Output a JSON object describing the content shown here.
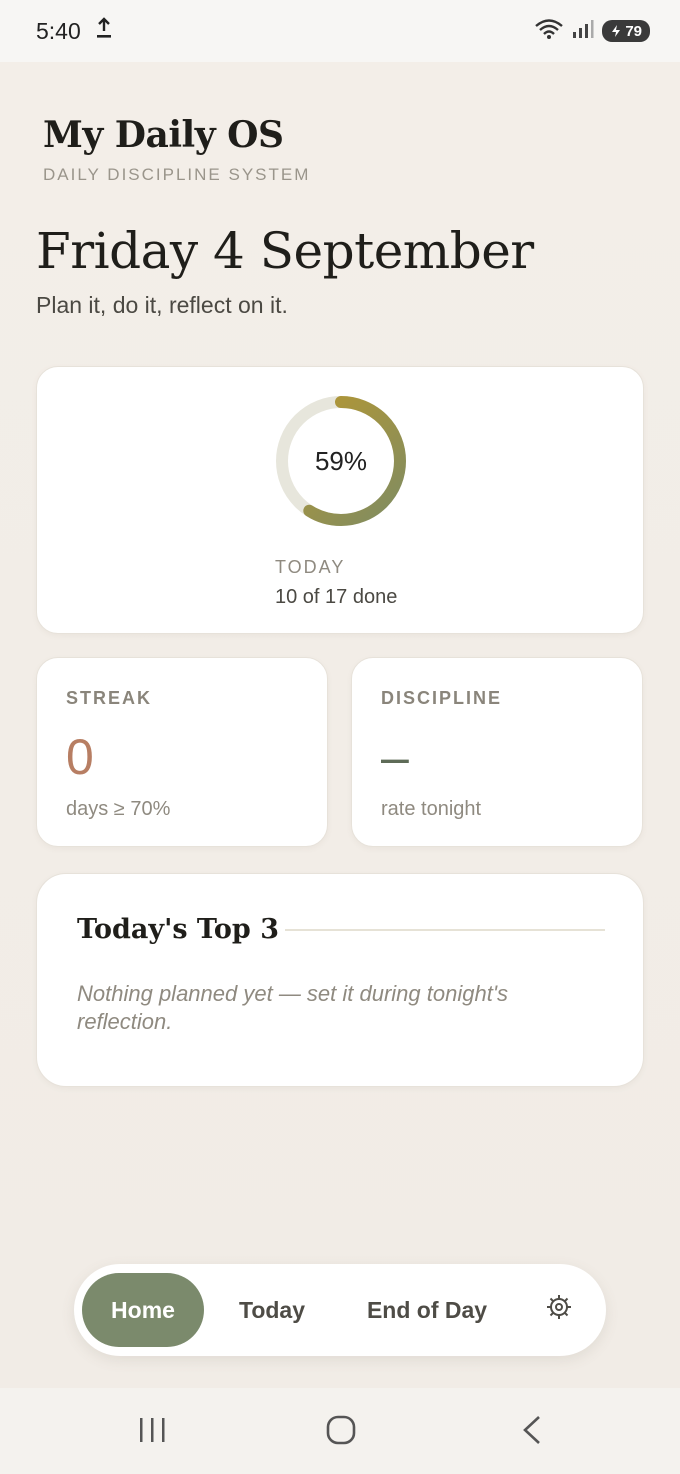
{
  "status_bar": {
    "time": "5:40",
    "battery": "79",
    "icons": [
      "upload-icon",
      "wifi-icon",
      "signal-icon",
      "battery-icon"
    ]
  },
  "header": {
    "app_title": "My Daily OS",
    "app_subtitle": "DAILY DISCIPLINE SYSTEM",
    "date": "Friday 4 September",
    "tagline": "Plan it, do it, reflect on it."
  },
  "progress": {
    "percent_label": "59%",
    "percent_value": 59,
    "label": "TODAY",
    "count_text": "10 of 17 done",
    "colors": {
      "track": "#e7e6dc",
      "start": "#7f8c62",
      "end": "#b9982f"
    }
  },
  "streak": {
    "label": "STREAK",
    "value": "0",
    "sub": "days ≥ 70%",
    "color": "#b77e63"
  },
  "discipline": {
    "label": "DISCIPLINE",
    "value": "–",
    "sub": "rate tonight"
  },
  "top3": {
    "title": "Today's Top 3",
    "empty_text": "Nothing planned yet — set it during tonight's reflection."
  },
  "nav": {
    "home": "Home",
    "today": "Today",
    "end_of_day": "End of Day",
    "settings_icon": "gear-icon",
    "active": "home",
    "active_color": "#7b8a6c"
  },
  "system_nav": {
    "icons": [
      "recents-icon",
      "home-circle-icon",
      "back-icon"
    ]
  }
}
